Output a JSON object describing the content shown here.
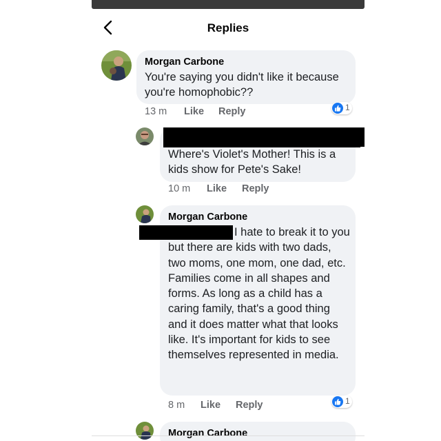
{
  "header": {
    "title": "Replies"
  },
  "comments": [
    {
      "author": "Morgan Carbone",
      "text": "You're saying you didn't like it because you're homophobic??",
      "time": "13 m",
      "like": "Like",
      "reply": "Reply",
      "reactions": "1"
    },
    {
      "author": "",
      "text": "Where's Violet's Mother! This is a kids show for Pete's Sake!",
      "time": "10 m",
      "like": "Like",
      "reply": "Reply"
    },
    {
      "author": "Morgan Carbone",
      "text": "I hate to break it to you but there are kids with two dads, two moms, one mom, one dad, etc. Families come in all shapes and forms. As long as a child has a caring family, that's a good thing and it does matter what that looks like. It's important for kids to see themselves represented in media.",
      "time": "8 m",
      "like": "Like",
      "reply": "Reply",
      "reactions": "1"
    },
    {
      "author": "Morgan Carbone"
    }
  ],
  "colors": {
    "accent": "#1877f2",
    "bubble": "#f0f2f5",
    "meta_text": "#65676b"
  },
  "icons": [
    "back-arrow-icon",
    "thumbs-up-icon"
  ]
}
